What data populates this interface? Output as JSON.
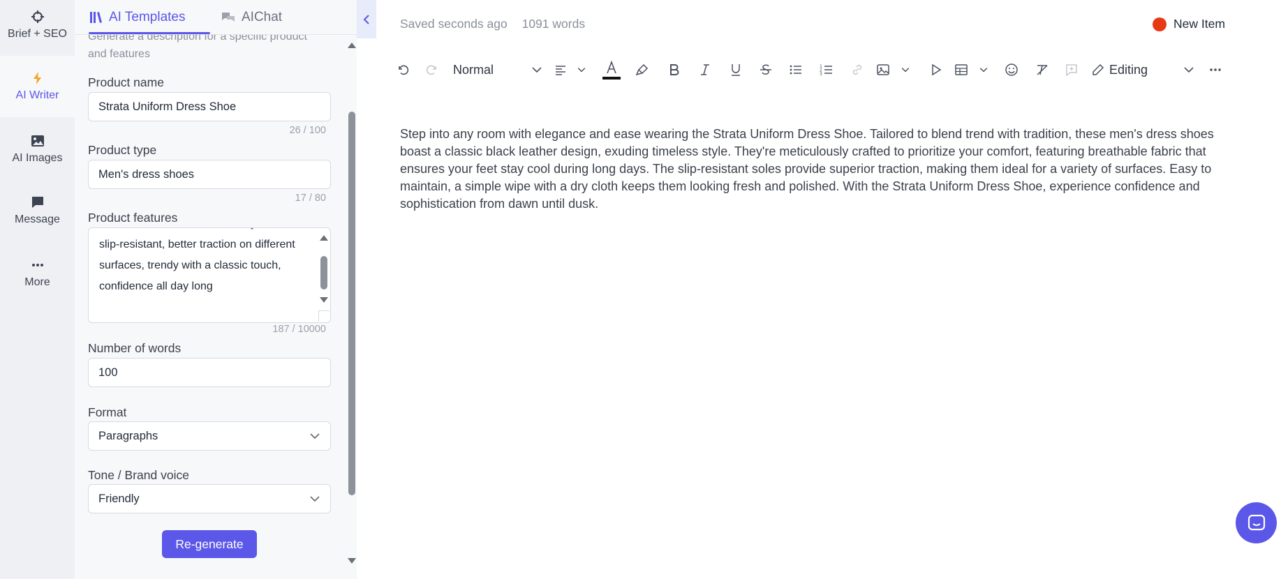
{
  "rail": {
    "items": [
      {
        "label": "Brief + SEO",
        "icon": "crosshair-icon"
      },
      {
        "label": "AI Writer",
        "icon": "bolt-icon"
      },
      {
        "label": "AI Images",
        "icon": "image-icon"
      },
      {
        "label": "Message",
        "icon": "message-icon"
      },
      {
        "label": "More",
        "icon": "more-icon"
      }
    ]
  },
  "panel": {
    "tabs": [
      {
        "label": "AI Templates",
        "icon": "books-icon"
      },
      {
        "label": "AIChat",
        "icon": "chat-icon"
      }
    ],
    "description": "Generate a description for a specific product and features",
    "product_name": {
      "label": "Product name",
      "value": "Strata Uniform Dress Shoe",
      "counter": "26 / 100"
    },
    "product_type": {
      "label": "Product type",
      "value": "Men's dress shoes",
      "counter": "17 / 80"
    },
    "product_features": {
      "label": "Product features",
      "value": "Material Leather, Clean with dry clothes, slip-resistant, better traction on different surfaces, trendy with a classic touch, confidence all day long",
      "counter": "187 / 10000"
    },
    "number_of_words": {
      "label": "Number of words",
      "value": "100"
    },
    "format": {
      "label": "Format",
      "value": "Paragraphs"
    },
    "tone": {
      "label": "Tone / Brand voice",
      "value": "Friendly"
    },
    "regenerate_label": "Re-generate"
  },
  "editor": {
    "saved_status": "Saved seconds ago",
    "word_count": "1091 words",
    "new_item_label": "New Item",
    "new_item_color": "#e73a14",
    "toolbar": {
      "style_label": "Normal",
      "mode_label": "Editing"
    },
    "content": "Step into any room with elegance and ease wearing the Strata Uniform Dress Shoe. Tailored to blend trend with tradition, these men's dress shoes boast a classic black leather design, exuding timeless style. They're meticulously crafted to prioritize your comfort, featuring breathable fabric that ensures your feet stay cool during long days. The slip-resistant soles provide superior traction, making them ideal for a variety of surfaces. Easy to maintain, a simple wipe with a dry cloth keeps them looking fresh and polished. With the Strata Uniform Dress Shoe, experience confidence and sophistication from dawn until dusk."
  },
  "colors": {
    "accent": "#5b57e8",
    "rail_bg": "#eef0f4",
    "panel_bg": "#f7f8fa"
  }
}
